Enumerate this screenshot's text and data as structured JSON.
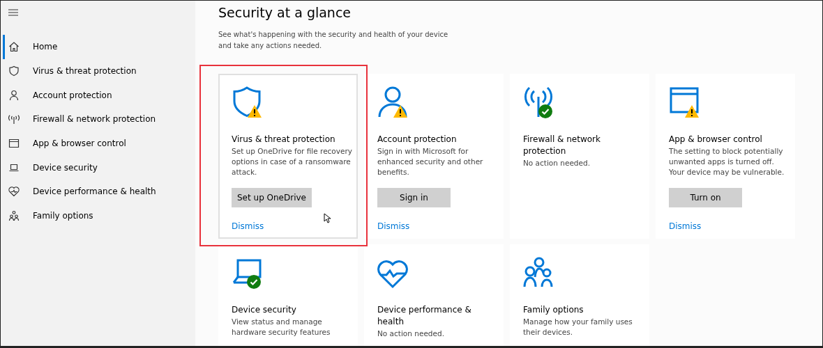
{
  "sidebar": {
    "items": [
      {
        "label": "Home",
        "kind": "home",
        "selected": true
      },
      {
        "label": "Virus & threat protection",
        "kind": "shield",
        "selected": false
      },
      {
        "label": "Account protection",
        "kind": "person",
        "selected": false
      },
      {
        "label": "Firewall & network protection",
        "kind": "antenna",
        "selected": false
      },
      {
        "label": "App & browser control",
        "kind": "window",
        "selected": false
      },
      {
        "label": "Device security",
        "kind": "laptop",
        "selected": false
      },
      {
        "label": "Device performance & health",
        "kind": "heart",
        "selected": false
      },
      {
        "label": "Family options",
        "kind": "family",
        "selected": false
      }
    ]
  },
  "page": {
    "title": "Security at a glance",
    "subtitle": "See what's happening with the security and health of your device and take any actions needed."
  },
  "tiles": [
    {
      "kind": "shield",
      "warning": true,
      "ok": false,
      "title": "Virus & threat protection",
      "description": "Set up OneDrive for file recovery options in case of a ransomware attack.",
      "button": "Set up OneDrive",
      "link": "Dismiss",
      "selected": true,
      "annotated": true
    },
    {
      "kind": "person",
      "warning": true,
      "ok": false,
      "title": "Account protection",
      "description": "Sign in with Microsoft for enhanced security and other benefits.",
      "button": "Sign in",
      "link": "Dismiss",
      "selected": false,
      "annotated": false
    },
    {
      "kind": "antenna",
      "warning": false,
      "ok": true,
      "title": "Firewall & network protection",
      "description": "No action needed.",
      "selected": false,
      "annotated": false
    },
    {
      "kind": "window",
      "warning": true,
      "ok": false,
      "title": "App & browser control",
      "description": "The setting to block potentially unwanted apps is turned off. Your device may be vulnerable.",
      "button": "Turn on",
      "link": "Dismiss",
      "selected": false,
      "annotated": false
    },
    {
      "kind": "laptop",
      "warning": false,
      "ok": true,
      "title": "Device security",
      "description": "View status and manage hardware security features",
      "selected": false,
      "annotated": false
    },
    {
      "kind": "heart",
      "warning": false,
      "ok": false,
      "title": "Device performance & health",
      "description": "No action needed.",
      "selected": false,
      "annotated": false
    },
    {
      "kind": "family",
      "warning": false,
      "ok": false,
      "title": "Family options",
      "description": "Manage how your family uses their devices.",
      "selected": false,
      "annotated": false
    }
  ]
}
